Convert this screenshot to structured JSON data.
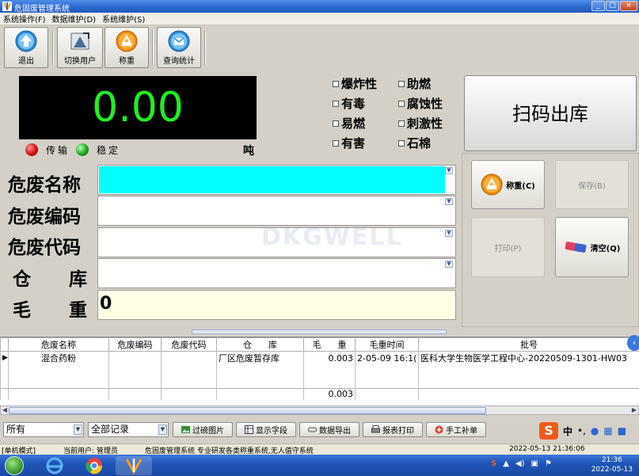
{
  "window": {
    "title": "危固废管理系统",
    "controls": [
      "_",
      "□",
      "×"
    ]
  },
  "menu": [
    "系统操作(F)",
    "数据维护(D)",
    "系统维护(S)"
  ],
  "toolbar": [
    {
      "label": "退出",
      "icon": "exit-up-arrow-icon"
    },
    {
      "label": "切换用户",
      "icon": "switch-user-icon"
    },
    {
      "label": "称重",
      "icon": "weigh-icon"
    },
    {
      "label": "查询统计",
      "icon": "query-stats-icon"
    }
  ],
  "scale": {
    "value": "0.00",
    "status_transmit": "传输",
    "status_stable": "稳定",
    "unit": "吨"
  },
  "properties": [
    "爆炸性",
    "助燃",
    "有毒",
    "腐蚀性",
    "易燃",
    "刺激性",
    "有害",
    "石棉"
  ],
  "scan_button": "扫码出库",
  "actions": {
    "weigh": "称重(C)",
    "save": "保存(B)",
    "print": "打印(P)",
    "clear": "清空(Q)"
  },
  "form": {
    "name_label": "危废名称",
    "code_label": "危废编码",
    "waste_code_label": "危废代码",
    "warehouse_label": "仓      库",
    "gross_label": "毛      重",
    "gross_value": "0"
  },
  "watermark": "DKGWELL",
  "table": {
    "columns": [
      "危废名称",
      "危废编码",
      "危废代码",
      "仓      库",
      "毛      重",
      "毛重时间",
      "批号"
    ],
    "rows": [
      [
        "混合药粉",
        "",
        "",
        "厂区危废暂存库",
        "0.003",
        "2-05-09 16:1(",
        "医科大学生物医学工程中心-20220509-1301-HW03"
      ]
    ],
    "total": "0.003"
  },
  "bottom": {
    "filter1": "所有",
    "filter2": "全部记录",
    "buttons": [
      "过磅图片",
      "显示字段",
      "数据导出",
      "报表打印",
      "手工补单"
    ]
  },
  "status": {
    "mode": "[单机模式]",
    "user": "当前用户: 管理员",
    "app": "危固废管理系统  专业研发各类称重系统,无人值守系统",
    "datetime": "2022-05-13 21:36:06"
  },
  "taskbar": {
    "time": "21:36",
    "date": "2022-05-13"
  },
  "colors": {
    "display_bg": "#000000",
    "display_digits": "#20f020",
    "name_field": "#00ffff",
    "gross_field": "#ffffe6"
  }
}
